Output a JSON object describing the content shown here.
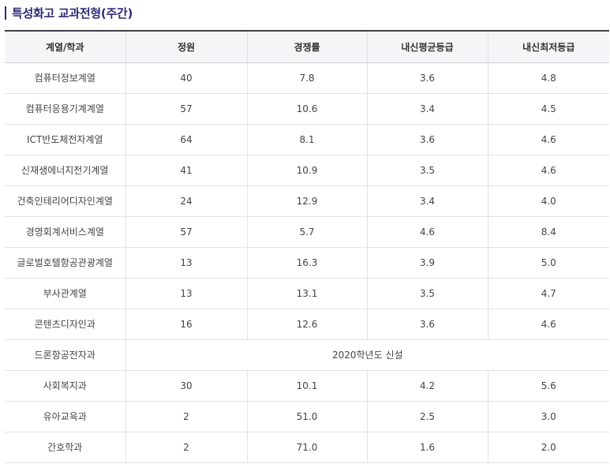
{
  "section": {
    "title": "특성화고 교과전형(주간)"
  },
  "table": {
    "headers": [
      "계열/학과",
      "정원",
      "경쟁률",
      "내신평균등급",
      "내신최저등급"
    ],
    "rows": [
      {
        "dept": "컴퓨터정보계열",
        "quota": "40",
        "rate": "7.8",
        "avg": "3.6",
        "min": "4.8"
      },
      {
        "dept": "컴퓨터응용기계계열",
        "quota": "57",
        "rate": "10.6",
        "avg": "3.4",
        "min": "4.5"
      },
      {
        "dept": "ICT반도체전자계열",
        "quota": "64",
        "rate": "8.1",
        "avg": "3.6",
        "min": "4.6"
      },
      {
        "dept": "신재생에너지전기계열",
        "quota": "41",
        "rate": "10.9",
        "avg": "3.5",
        "min": "4.6"
      },
      {
        "dept": "건축인테리어디자인계열",
        "quota": "24",
        "rate": "12.9",
        "avg": "3.4",
        "min": "4.0"
      },
      {
        "dept": "경영회계서비스계열",
        "quota": "57",
        "rate": "5.7",
        "avg": "4.6",
        "min": "8.4"
      },
      {
        "dept": "글로벌호텔항공관광계열",
        "quota": "13",
        "rate": "16.3",
        "avg": "3.9",
        "min": "5.0"
      },
      {
        "dept": "부사관계열",
        "quota": "13",
        "rate": "13.1",
        "avg": "3.5",
        "min": "4.7"
      },
      {
        "dept": "콘텐츠디자인과",
        "quota": "16",
        "rate": "12.6",
        "avg": "3.6",
        "min": "4.6"
      },
      {
        "dept": "드론항공전자과",
        "note": "2020학년도 신설"
      },
      {
        "dept": "사회복지과",
        "quota": "30",
        "rate": "10.1",
        "avg": "4.2",
        "min": "5.6"
      },
      {
        "dept": "유아교육과",
        "quota": "2",
        "rate": "51.0",
        "avg": "2.5",
        "min": "3.0"
      },
      {
        "dept": "간호학과",
        "quota": "2",
        "rate": "71.0",
        "avg": "1.6",
        "min": "2.0"
      }
    ]
  }
}
